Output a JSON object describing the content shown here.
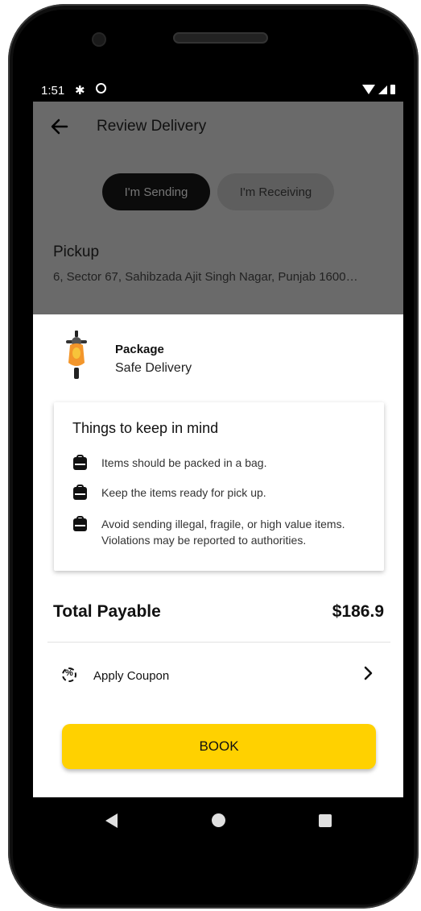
{
  "status_bar": {
    "time": "1:51"
  },
  "header": {
    "title": "Review Delivery"
  },
  "mode_toggle": {
    "sending": "I'm Sending",
    "receiving": "I'm Receiving",
    "selected": "sending"
  },
  "pickup": {
    "label": "Pickup",
    "address": "6, Sector 67, Sahibzada Ajit Singh Nagar, Punjab 1600…"
  },
  "package": {
    "title": "Package",
    "subtitle": "Safe Delivery"
  },
  "tips": {
    "title": "Things to keep in mind",
    "items": [
      "Items should be packed in a bag.",
      "Keep the items ready for pick up.",
      "Avoid sending illegal, fragile, or high value items. Violations may be reported to authorities."
    ]
  },
  "total": {
    "label": "Total Payable",
    "value": "$186.9"
  },
  "coupon": {
    "label": "Apply Coupon"
  },
  "book_button": {
    "label": "BOOK"
  },
  "colors": {
    "accent": "#ffd100",
    "scrim": "#6a6a6a"
  },
  "icons": [
    "back-arrow-icon",
    "scooter-icon",
    "bag-icon",
    "coupon-icon",
    "chevron-right-icon",
    "gear-icon",
    "sync-icon",
    "wifi-icon",
    "signal-icon",
    "battery-icon"
  ]
}
